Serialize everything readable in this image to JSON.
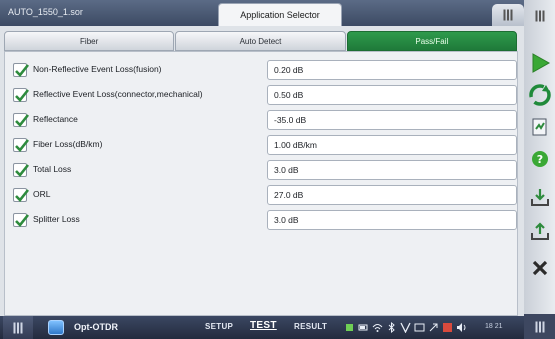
{
  "window": {
    "file_name": "AUTO_1550_1.sor",
    "app_selector_label": "Application Selector"
  },
  "tabs": [
    {
      "label": "Fiber",
      "active": false
    },
    {
      "label": "Auto Detect",
      "active": false
    },
    {
      "label": "Pass/Fail",
      "active": true
    }
  ],
  "thresholds": [
    {
      "label": "Non-Reflective Event Loss(fusion)",
      "value": "0.20 dB",
      "checked": true
    },
    {
      "label": "Reflective Event Loss(connector,mechanical)",
      "value": "0.50 dB",
      "checked": true
    },
    {
      "label": "Reflectance",
      "value": "-35.0 dB",
      "checked": true
    },
    {
      "label": "Fiber Loss(dB/km)",
      "value": "1.00 dB/km",
      "checked": true
    },
    {
      "label": "Total Loss",
      "value": "3.0 dB",
      "checked": true
    },
    {
      "label": "ORL",
      "value": "27.0 dB",
      "checked": true
    },
    {
      "label": "Splitter Loss",
      "value": "3.0 dB",
      "checked": true
    }
  ],
  "right_toolbar": {
    "buttons": [
      "play-icon",
      "refresh-icon",
      "report-icon",
      "help-icon",
      "download-icon",
      "upload-icon",
      "close-icon"
    ],
    "colors": {
      "play": "#3aa835",
      "refresh": "#1f8a3a",
      "help": "#3aa835",
      "close": "#2b2b2b"
    }
  },
  "taskbar": {
    "app_name": "Opt-OTDR",
    "setup_label": "SETUP",
    "test_label": "TEST",
    "result_label": "RESULT",
    "time": "18 21"
  },
  "colors": {
    "active_tab": "#1f7a3a",
    "title_bar": "#3c4a63"
  }
}
